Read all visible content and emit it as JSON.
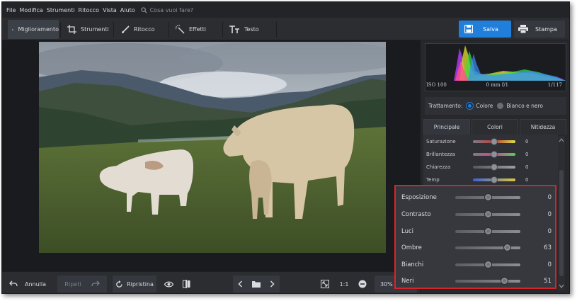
{
  "menu": {
    "items": [
      "File",
      "Modifica",
      "Strumenti",
      "Ritocco",
      "Vista",
      "Aiuto"
    ],
    "search_placeholder": "Cosa vuoi fare?"
  },
  "toolbar": {
    "tabs": [
      {
        "label": "Miglioramento",
        "icon": "sliders-icon",
        "active": true
      },
      {
        "label": "Strumenti",
        "icon": "crop-icon",
        "active": false
      },
      {
        "label": "Ritocco",
        "icon": "brush-icon",
        "active": false
      },
      {
        "label": "Effetti",
        "icon": "magic-wand-icon",
        "active": false
      },
      {
        "label": "Testo",
        "icon": "text-icon",
        "active": false
      }
    ],
    "save_label": "Salva",
    "print_label": "Stampa"
  },
  "bottombar": {
    "undo_label": "Annulla",
    "redo_label": "Ripeti",
    "reset_label": "Ripristina",
    "ratio_label": "1:1",
    "zoom_label": "30%"
  },
  "histogram": {
    "iso": "ISO 100",
    "focal": "0 mm f/1",
    "shutter": "1/117"
  },
  "treatment": {
    "label": "Trattamento:",
    "options": [
      "Colore",
      "Bianco e nero"
    ],
    "selected": "Colore"
  },
  "panel_tabs": [
    {
      "label": "Principale",
      "active": true
    },
    {
      "label": "Colori",
      "active": false
    },
    {
      "label": "Nitidezza",
      "active": false
    }
  ],
  "small_sliders": [
    {
      "label": "Saturazione",
      "value": "0",
      "level": 0.5
    },
    {
      "label": "Brillantezza",
      "value": "0",
      "level": 0.5
    },
    {
      "label": "Chiarezza",
      "value": "0",
      "level": 0.5
    },
    {
      "label": "Temp",
      "value": "0",
      "level": 0.5
    }
  ],
  "adjust_sliders": [
    {
      "label": "Esposizione",
      "value": "0",
      "level": 0.5
    },
    {
      "label": "Contrasto",
      "value": "0",
      "level": 0.5
    },
    {
      "label": "Luci",
      "value": "0",
      "level": 0.5
    },
    {
      "label": "Ombre",
      "value": "63",
      "level": 0.8
    },
    {
      "label": "Bianchi",
      "value": "0",
      "level": 0.5
    },
    {
      "label": "Neri",
      "value": "51",
      "level": 0.75
    }
  ],
  "colors": {
    "accent": "#1f7fdb",
    "highlight_border": "#d6252a",
    "radio_selected": "#1f7fdb"
  }
}
